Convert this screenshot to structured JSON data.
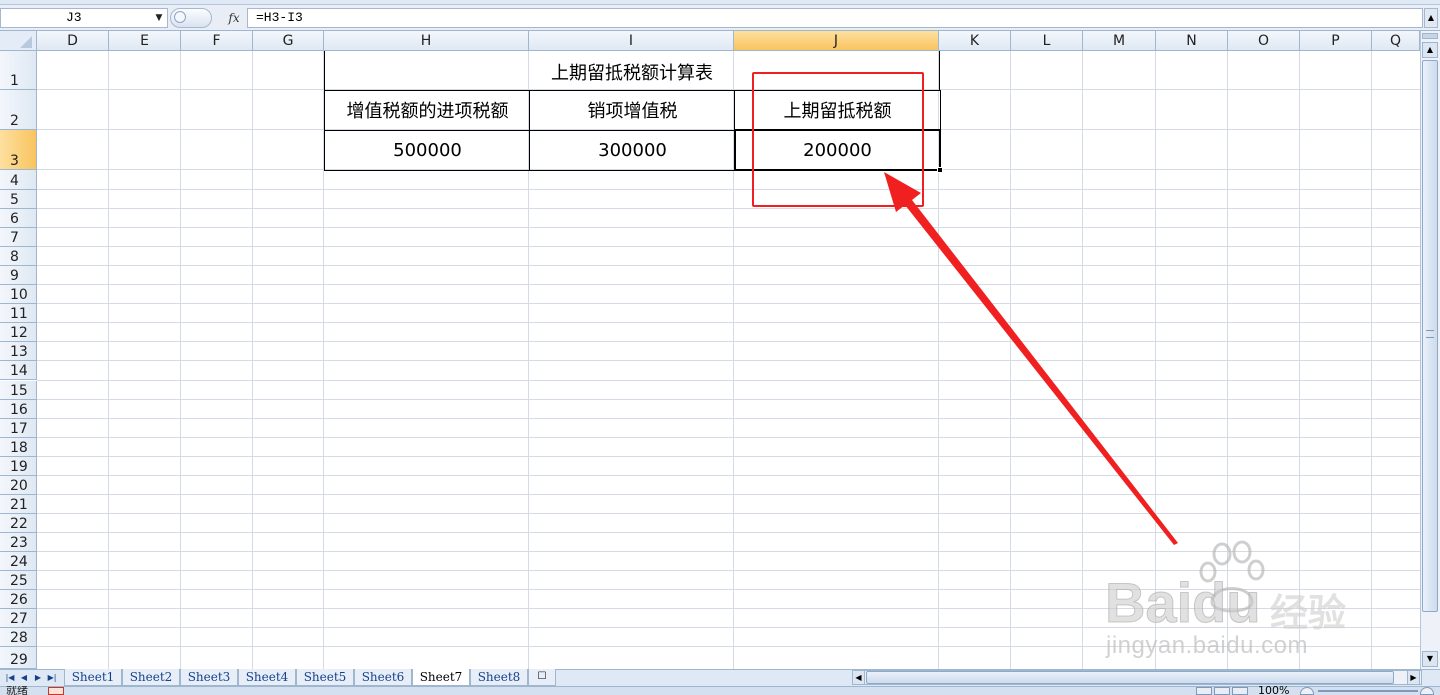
{
  "formula_bar": {
    "name_box": "J3",
    "fx_label": "fx",
    "formula": "=H3-I3"
  },
  "columns": [
    "D",
    "E",
    "F",
    "G",
    "H",
    "I",
    "J",
    "K",
    "L",
    "M",
    "N",
    "O",
    "P",
    "Q"
  ],
  "selected_column": "J",
  "rows": [
    "1",
    "2",
    "3",
    "4",
    "5",
    "6",
    "7",
    "8",
    "9",
    "10",
    "11",
    "12",
    "13",
    "14",
    "15",
    "16",
    "17",
    "18",
    "19",
    "20",
    "21",
    "22",
    "23",
    "24",
    "25",
    "26",
    "27",
    "28",
    "29"
  ],
  "selected_row": "3",
  "table": {
    "title": "上期留抵税额计算表",
    "headers": [
      "增值税额的进项税额",
      "销项增值税",
      "上期留抵税额"
    ],
    "values": [
      "500000",
      "300000",
      "200000"
    ]
  },
  "sheet_tabs": [
    "Sheet1",
    "Sheet2",
    "Sheet3",
    "Sheet4",
    "Sheet5",
    "Sheet6",
    "Sheet7",
    "Sheet8"
  ],
  "active_sheet": "Sheet7",
  "status_bar": {
    "ready": "就绪",
    "zoom": "100%"
  },
  "watermark": {
    "brand": "Bai",
    "brand2": "du",
    "product": "经验",
    "url": "jingyan.baidu.com"
  },
  "annotation_color": "#f02020",
  "selection_color": "#f9c45e"
}
